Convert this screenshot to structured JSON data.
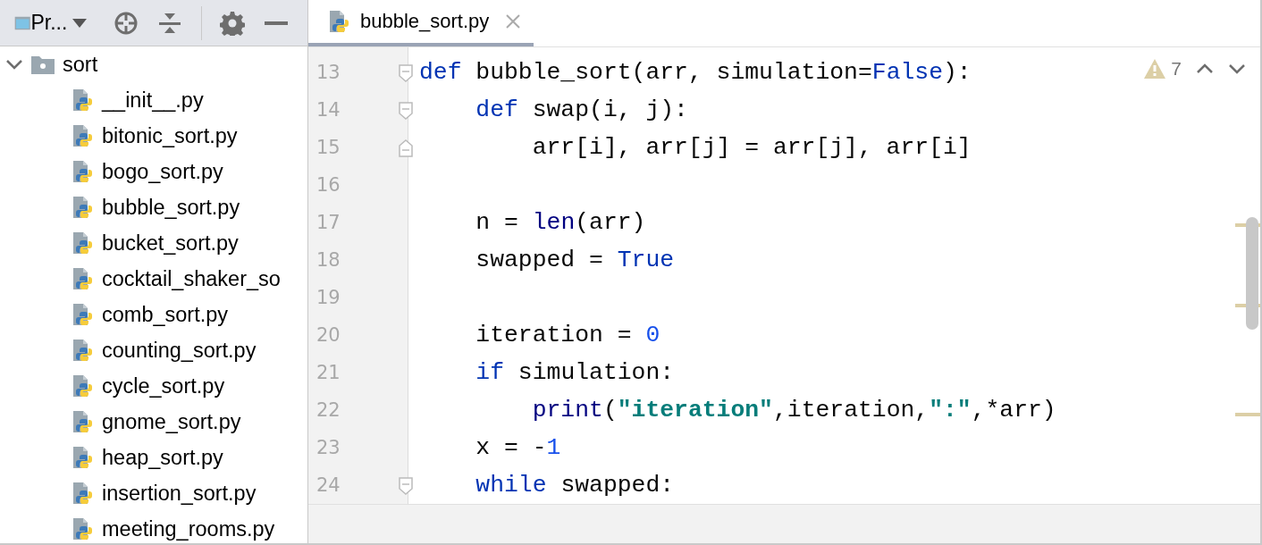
{
  "project_panel": {
    "title": "Pr...",
    "tree": [
      {
        "label": "sort",
        "kind": "folder",
        "expanded": true,
        "children": [
          {
            "label": "__init__.py",
            "kind": "python"
          },
          {
            "label": "bitonic_sort.py",
            "kind": "python"
          },
          {
            "label": "bogo_sort.py",
            "kind": "python"
          },
          {
            "label": "bubble_sort.py",
            "kind": "python"
          },
          {
            "label": "bucket_sort.py",
            "kind": "python"
          },
          {
            "label": "cocktail_shaker_so",
            "kind": "python"
          },
          {
            "label": "comb_sort.py",
            "kind": "python"
          },
          {
            "label": "counting_sort.py",
            "kind": "python"
          },
          {
            "label": "cycle_sort.py",
            "kind": "python"
          },
          {
            "label": "gnome_sort.py",
            "kind": "python"
          },
          {
            "label": "heap_sort.py",
            "kind": "python"
          },
          {
            "label": "insertion_sort.py",
            "kind": "python"
          },
          {
            "label": "meeting_rooms.py",
            "kind": "python"
          }
        ]
      }
    ]
  },
  "tabs": [
    {
      "label": "bubble_sort.py",
      "selected": true
    }
  ],
  "inspections": {
    "warnings": "7"
  },
  "editor": {
    "lines": [
      {
        "number": "13",
        "fold_start": true,
        "tokens": [
          {
            "text": "def",
            "kind": "keyword"
          },
          {
            "text": " bubble_sort(arr, simulation=",
            "kind": "plain"
          },
          {
            "text": "False",
            "kind": "keyword"
          },
          {
            "text": "):",
            "kind": "plain"
          }
        ]
      },
      {
        "number": "14",
        "fold_start": true,
        "tokens": [
          {
            "text": "    def",
            "kind": "keyword"
          },
          {
            "text": " swap(i, j):",
            "kind": "plain"
          }
        ]
      },
      {
        "number": "15",
        "fold_end": true,
        "tokens": [
          {
            "text": "        arr[i], arr[j] = arr[j], arr[i]",
            "kind": "plain"
          }
        ]
      },
      {
        "number": "16"
      },
      {
        "number": "17",
        "tokens": [
          {
            "text": "    n = ",
            "kind": "plain"
          },
          {
            "text": "len",
            "kind": "builtin"
          },
          {
            "text": "(arr)",
            "kind": "plain"
          }
        ]
      },
      {
        "number": "18",
        "tokens": [
          {
            "text": "    swapped = ",
            "kind": "plain"
          },
          {
            "text": "True",
            "kind": "keyword"
          }
        ]
      },
      {
        "number": "19"
      },
      {
        "number": "20",
        "tokens": [
          {
            "text": "    iteration = ",
            "kind": "plain"
          },
          {
            "text": "0",
            "kind": "number"
          }
        ]
      },
      {
        "number": "21",
        "tokens": [
          {
            "text": "    if",
            "kind": "keyword"
          },
          {
            "text": " simulation:",
            "kind": "plain"
          }
        ]
      },
      {
        "number": "22",
        "tokens": [
          {
            "text": "        print",
            "kind": "builtin"
          },
          {
            "text": "(",
            "kind": "plain"
          },
          {
            "text": "\"iteration\"",
            "kind": "string"
          },
          {
            "text": ",iteration,",
            "kind": "plain"
          },
          {
            "text": "\":\"",
            "kind": "string"
          },
          {
            "text": ",*arr)",
            "kind": "plain"
          }
        ]
      },
      {
        "number": "23",
        "tokens": [
          {
            "text": "    x = -",
            "kind": "plain"
          },
          {
            "text": "1",
            "kind": "number"
          }
        ]
      },
      {
        "number": "24",
        "fold_start": true,
        "tokens": [
          {
            "text": "    while",
            "kind": "keyword"
          },
          {
            "text": " swapped:",
            "kind": "plain"
          }
        ]
      }
    ]
  }
}
